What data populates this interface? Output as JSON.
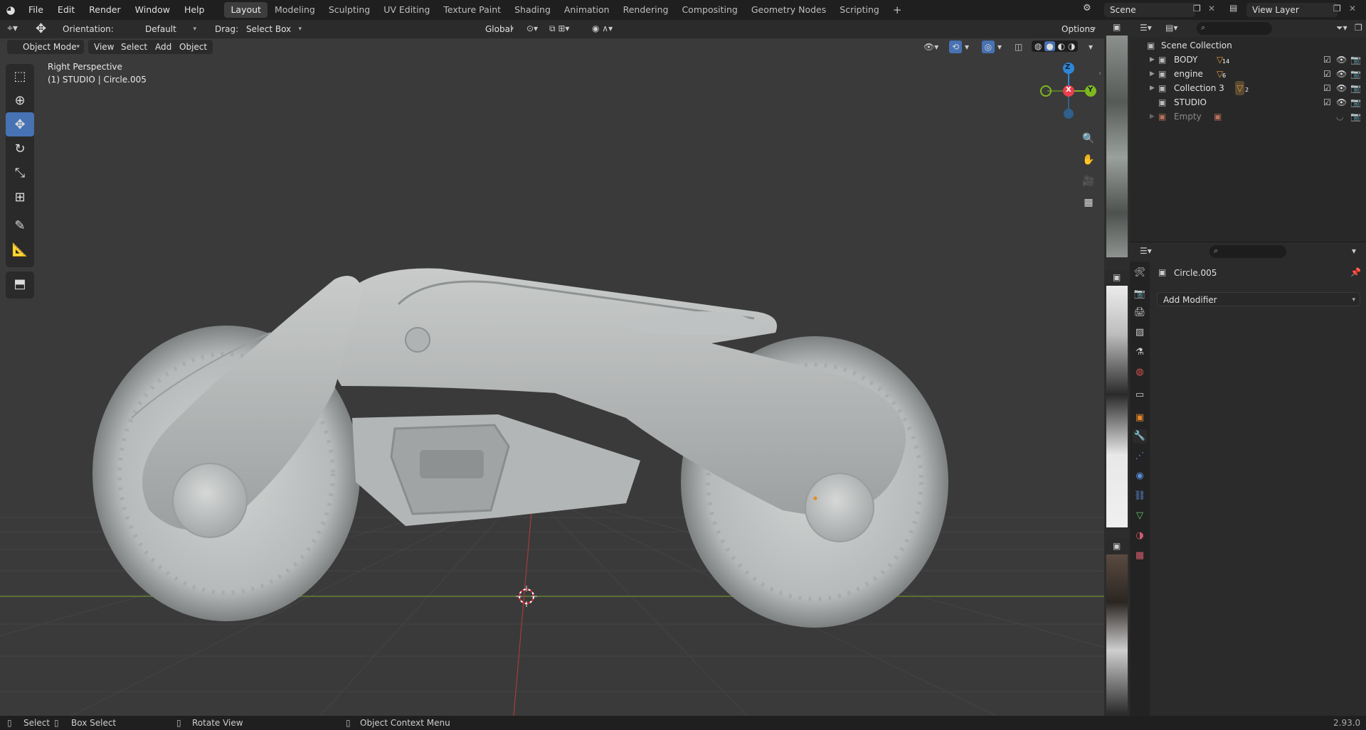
{
  "topbar": {
    "menus": [
      "File",
      "Edit",
      "Render",
      "Window",
      "Help"
    ],
    "tabs": [
      "Layout",
      "Modeling",
      "Sculpting",
      "UV Editing",
      "Texture Paint",
      "Shading",
      "Animation",
      "Rendering",
      "Compositing",
      "Geometry Nodes",
      "Scripting"
    ],
    "active_tab": "Layout",
    "add_tab": "+",
    "scene": "Scene",
    "view_layer": "View Layer"
  },
  "toolheader": {
    "orientation_label": "Orientation:",
    "orientation_value": "Default",
    "drag_label": "Drag:",
    "drag_value": "Select Box",
    "transform_orientation": "Global",
    "options": "Options"
  },
  "viewport_header": {
    "mode": "Object Mode",
    "menus": [
      "View",
      "Select",
      "Add",
      "Object"
    ]
  },
  "viewport": {
    "view_name": "Right Perspective",
    "object_info": "(1) STUDIO | Circle.005",
    "gizmo": {
      "x": "X",
      "y": "Y",
      "z": "Z"
    }
  },
  "outliner": {
    "root": "Scene Collection",
    "items": [
      {
        "name": "BODY",
        "badge": "14",
        "dim": false
      },
      {
        "name": "engine",
        "badge": "6",
        "dim": false
      },
      {
        "name": "Collection 3",
        "badge": "2",
        "dim": false
      },
      {
        "name": "STUDIO",
        "badge": "",
        "dim": false
      },
      {
        "name": "Empty",
        "badge": "",
        "dim": true
      }
    ]
  },
  "properties": {
    "object_name": "Circle.005",
    "add_modifier": "Add Modifier"
  },
  "statusbar": {
    "select": "Select",
    "box_select": "Box Select",
    "rotate_view": "Rotate View",
    "context_menu": "Object Context Menu",
    "version": "2.93.0"
  },
  "colors": {
    "accent": "#4772b3",
    "axis_x": "#e8404d",
    "axis_y": "#7fb81e",
    "axis_z": "#2f86d6"
  }
}
